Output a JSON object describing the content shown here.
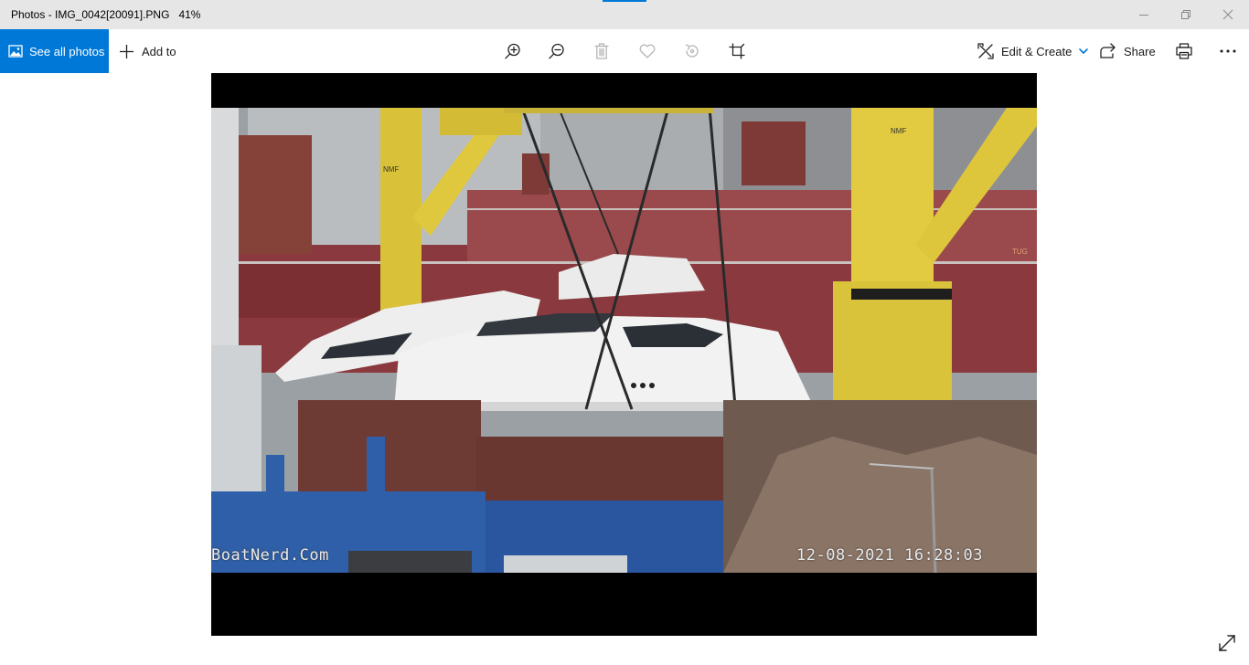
{
  "window": {
    "title": "Photos - IMG_0042[20091].PNG",
    "zoom": "41%"
  },
  "toolbar": {
    "see_all_label": "See all photos",
    "add_to_label": "Add to",
    "edit_create_label": "Edit & Create",
    "share_label": "Share",
    "icons": [
      "zoom-in-icon",
      "zoom-out-icon",
      "delete-icon",
      "favorite-icon",
      "rotate-icon",
      "crop-icon",
      "edit-create-icon",
      "share-icon",
      "print-icon",
      "more-icon"
    ]
  },
  "photo": {
    "watermark": "BoatNerd.Com",
    "timestamp": "12-08-2021 16:28:03",
    "sign_nmf_left": "NMF",
    "sign_nmf_right": "NMF",
    "sign_tug": "TUG"
  },
  "colors": {
    "accent": "#0078d7",
    "titlebar_bg": "#e6e6e6"
  }
}
